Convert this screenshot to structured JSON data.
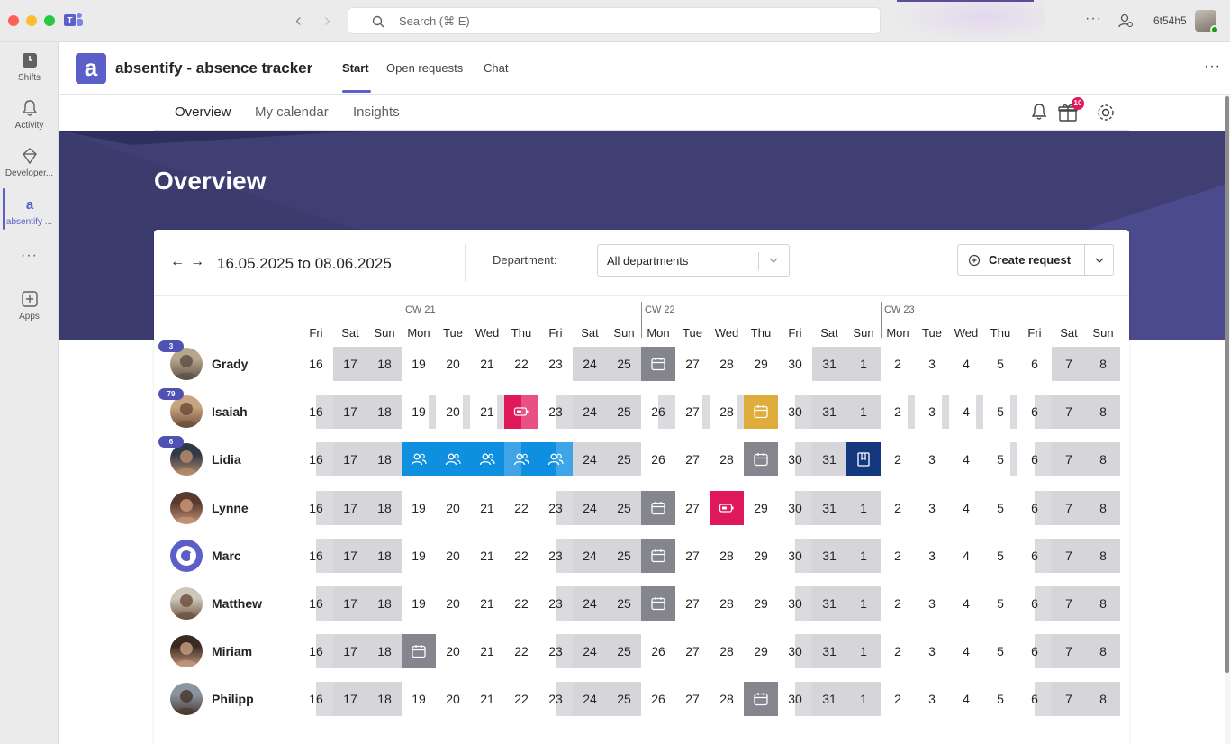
{
  "titlebar": {
    "search_placeholder": "Search (⌘ E)",
    "user_name": "6t54h5"
  },
  "rail": {
    "items": [
      {
        "label": "Shifts",
        "icon": "shifts-icon"
      },
      {
        "label": "Activity",
        "icon": "bell-icon"
      },
      {
        "label": "Developer...",
        "icon": "developer-icon"
      },
      {
        "label": "absentify ...",
        "icon": "absentify-icon"
      },
      {
        "label": "",
        "icon": "more-icon"
      },
      {
        "label": "Apps",
        "icon": "add-apps-icon"
      }
    ]
  },
  "app": {
    "logo_letter": "a",
    "title": "absentify - absence tracker",
    "tabs": [
      "Start",
      "Open requests",
      "Chat"
    ],
    "active_tab": "Start"
  },
  "subnav": {
    "tabs": [
      "Overview",
      "My calendar",
      "Insights"
    ],
    "active_tab": "Overview",
    "gift_count": "10"
  },
  "hero": {
    "title": "Overview"
  },
  "toolbar": {
    "date_range": "16.05.2025 to 08.06.2025",
    "department_label": "Department:",
    "department_value": "All departments",
    "create_label": "Create request"
  },
  "colors": {
    "accent": "#5b5fc7",
    "hero": "#3b3b6d",
    "teamwork": "#0f8fe0",
    "sick": "#e0195a",
    "vacation_pending": "#dfad3c",
    "vacation": "#85858d",
    "training": "#14387f"
  },
  "calendar": {
    "weeks": [
      {
        "label": "CW 21",
        "start_index": 3
      },
      {
        "label": "CW 22",
        "start_index": 10
      },
      {
        "label": "CW 23",
        "start_index": 17
      }
    ],
    "days": [
      {
        "dow": "Fri",
        "day": "16"
      },
      {
        "dow": "Sat",
        "day": "17"
      },
      {
        "dow": "Sun",
        "day": "18"
      },
      {
        "dow": "Mon",
        "day": "19"
      },
      {
        "dow": "Tue",
        "day": "20"
      },
      {
        "dow": "Wed",
        "day": "21"
      },
      {
        "dow": "Thu",
        "day": "22"
      },
      {
        "dow": "Fri",
        "day": "23"
      },
      {
        "dow": "Sat",
        "day": "24"
      },
      {
        "dow": "Sun",
        "day": "25"
      },
      {
        "dow": "Mon",
        "day": "26"
      },
      {
        "dow": "Tue",
        "day": "27"
      },
      {
        "dow": "Wed",
        "day": "28"
      },
      {
        "dow": "Thu",
        "day": "29"
      },
      {
        "dow": "Fri",
        "day": "30"
      },
      {
        "dow": "Sat",
        "day": "31"
      },
      {
        "dow": "Sun",
        "day": "1"
      },
      {
        "dow": "Mon",
        "day": "2"
      },
      {
        "dow": "Tue",
        "day": "3"
      },
      {
        "dow": "Wed",
        "day": "4"
      },
      {
        "dow": "Thu",
        "day": "5"
      },
      {
        "dow": "Fri",
        "day": "6"
      },
      {
        "dow": "Sat",
        "day": "7"
      },
      {
        "dow": "Sun",
        "day": "8"
      }
    ],
    "people": [
      {
        "name": "Grady",
        "badge": "3",
        "avatar": "photo",
        "cells": [
          "",
          "weekend",
          "weekend",
          "",
          "",
          "",
          "",
          "",
          "weekend",
          "weekend",
          "vacation",
          "",
          "",
          "",
          "",
          "weekend",
          "weekend",
          "",
          "",
          "",
          "",
          "",
          "weekend",
          "weekend"
        ]
      },
      {
        "name": "Isaiah",
        "badge": "79",
        "avatar": "photo",
        "cells": [
          "half",
          "weekend",
          "weekend",
          "half-right",
          "half-right",
          "half-right",
          "sick-half",
          "half",
          "weekend",
          "weekend",
          "half",
          "half-right",
          "half-right",
          "vacation-pending",
          "half",
          "weekend",
          "weekend",
          "half-right",
          "half-right",
          "half-right",
          "half-right",
          "half",
          "weekend",
          "weekend"
        ]
      },
      {
        "name": "Lidia",
        "badge": "6",
        "avatar": "photo",
        "cells": [
          "half",
          "weekend",
          "weekend",
          "teamwork",
          "teamwork",
          "teamwork",
          "teamwork-half",
          "teamwork-half2",
          "weekend",
          "weekend",
          "",
          "",
          "",
          "vacation",
          "half",
          "weekend",
          "training",
          "",
          "",
          "",
          "half-right",
          "half",
          "weekend",
          "weekend"
        ]
      },
      {
        "name": "Lynne",
        "badge": "",
        "avatar": "photo",
        "cells": [
          "half",
          "weekend",
          "weekend",
          "",
          "",
          "",
          "",
          "half",
          "weekend",
          "weekend",
          "vacation",
          "",
          "sick",
          "",
          "half",
          "weekend",
          "weekend",
          "",
          "",
          "",
          "",
          "half",
          "weekend",
          "weekend"
        ]
      },
      {
        "name": "Marc",
        "badge": "",
        "avatar": "logo",
        "cells": [
          "half",
          "weekend",
          "weekend",
          "",
          "",
          "",
          "",
          "half",
          "weekend",
          "weekend",
          "vacation",
          "",
          "",
          "",
          "half",
          "weekend",
          "weekend",
          "",
          "",
          "",
          "",
          "half",
          "weekend",
          "weekend"
        ]
      },
      {
        "name": "Matthew",
        "badge": "",
        "avatar": "photo",
        "cells": [
          "half",
          "weekend",
          "weekend",
          "",
          "",
          "",
          "",
          "half",
          "weekend",
          "weekend",
          "vacation",
          "",
          "",
          "",
          "half",
          "weekend",
          "weekend",
          "",
          "",
          "",
          "",
          "half",
          "weekend",
          "weekend"
        ]
      },
      {
        "name": "Miriam",
        "badge": "",
        "avatar": "photo",
        "cells": [
          "half",
          "weekend",
          "weekend",
          "vacation",
          "",
          "",
          "",
          "half",
          "weekend",
          "weekend",
          "",
          "",
          "",
          "",
          "half",
          "weekend",
          "weekend",
          "",
          "",
          "",
          "",
          "half",
          "weekend",
          "weekend"
        ]
      },
      {
        "name": "Philipp",
        "badge": "",
        "avatar": "photo",
        "cells": [
          "half",
          "weekend",
          "weekend",
          "",
          "",
          "",
          "",
          "half",
          "weekend",
          "weekend",
          "",
          "",
          "",
          "vacation",
          "half",
          "weekend",
          "weekend",
          "",
          "",
          "",
          "",
          "half",
          "weekend",
          "weekend"
        ]
      }
    ]
  }
}
